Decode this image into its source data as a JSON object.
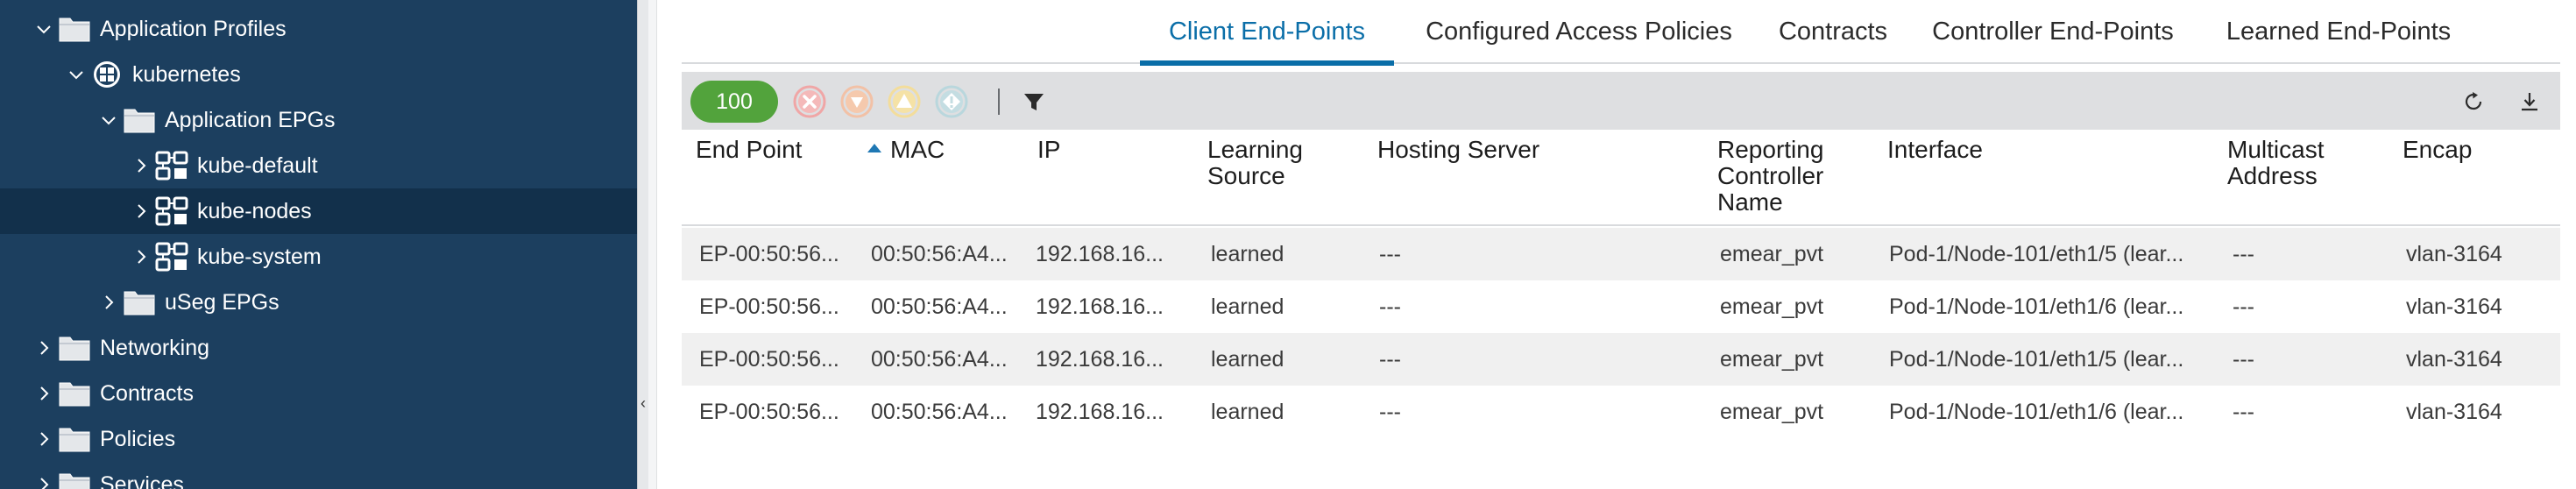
{
  "sidebar": {
    "items": [
      {
        "label": "Application Profiles",
        "icon": "folder-icon",
        "expanded": true,
        "selected": false
      },
      {
        "label": "kubernetes",
        "icon": "application-profile-icon",
        "expanded": true,
        "selected": false
      },
      {
        "label": "Application EPGs",
        "icon": "folder-icon",
        "expanded": true,
        "selected": false
      },
      {
        "label": "kube-default",
        "icon": "epg-icon",
        "expanded": false,
        "selected": false
      },
      {
        "label": "kube-nodes",
        "icon": "epg-icon",
        "expanded": false,
        "selected": true
      },
      {
        "label": "kube-system",
        "icon": "epg-icon",
        "expanded": false,
        "selected": false
      },
      {
        "label": "uSeg EPGs",
        "icon": "folder-icon",
        "expanded": false,
        "selected": false
      },
      {
        "label": "Networking",
        "icon": "folder-icon",
        "expanded": false,
        "selected": false
      },
      {
        "label": "Contracts",
        "icon": "folder-icon",
        "expanded": false,
        "selected": false
      },
      {
        "label": "Policies",
        "icon": "folder-icon",
        "expanded": false,
        "selected": false
      },
      {
        "label": "Services",
        "icon": "folder-icon",
        "expanded": false,
        "selected": false
      }
    ]
  },
  "tabs": [
    {
      "label": "Client End-Points",
      "active": true
    },
    {
      "label": "Configured Access Policies",
      "active": false
    },
    {
      "label": "Contracts",
      "active": false
    },
    {
      "label": "Controller End-Points",
      "active": false
    },
    {
      "label": "Learned End-Points",
      "active": false
    }
  ],
  "toolbar": {
    "count": "100",
    "fault_icons": [
      "critical-fault-icon",
      "major-fault-icon",
      "minor-fault-icon",
      "warning-fault-icon"
    ],
    "filter_icon": "filter-icon",
    "refresh_icon": "refresh-icon",
    "download_icon": "download-icon"
  },
  "table": {
    "columns": [
      "End Point",
      "MAC",
      "IP",
      "Learning Source",
      "Hosting Server",
      "Reporting Controller Name",
      "Interface",
      "Multicast Address",
      "Encap"
    ],
    "sorted_column": "MAC",
    "rows": [
      [
        "EP-00:50:56...",
        "00:50:56:A4...",
        "192.168.16...",
        "learned",
        "---",
        "emear_pvt",
        "Pod-1/Node-101/eth1/5 (lear...",
        "---",
        "vlan-3164"
      ],
      [
        "EP-00:50:56...",
        "00:50:56:A4...",
        "192.168.16...",
        "learned",
        "---",
        "emear_pvt",
        "Pod-1/Node-101/eth1/6 (lear...",
        "---",
        "vlan-3164"
      ],
      [
        "EP-00:50:56...",
        "00:50:56:A4...",
        "192.168.16...",
        "learned",
        "---",
        "emear_pvt",
        "Pod-1/Node-101/eth1/5 (lear...",
        "---",
        "vlan-3164"
      ],
      [
        "EP-00:50:56...",
        "00:50:56:A4...",
        "192.168.16...",
        "learned",
        "---",
        "emear_pvt",
        "Pod-1/Node-101/eth1/6 (lear...",
        "---",
        "vlan-3164"
      ]
    ]
  },
  "colors": {
    "sidebar_bg": "#1c3f5f",
    "sidebar_selected": "#12304b",
    "accent": "#0a6ea8",
    "count_badge": "#52a33c",
    "toolbar_bg": "#dedfe1"
  }
}
